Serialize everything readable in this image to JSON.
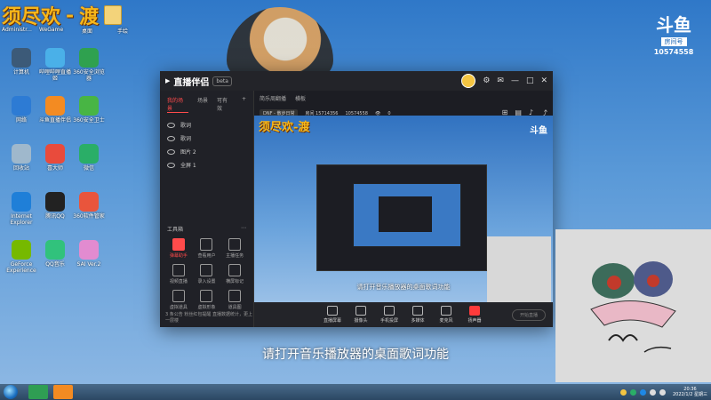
{
  "desktop": {
    "banner": {
      "text1": "须尽欢",
      "dash": "-",
      "text2": "渡"
    },
    "top_labels": [
      "Administr...",
      "WeGame",
      "桌面",
      "手绘"
    ],
    "icons": [
      {
        "label": "计算机",
        "color": "#3c5a78"
      },
      {
        "label": "哔哩哔哩直播姬",
        "color": "#4ab0e8"
      },
      {
        "label": "360安全浏览器",
        "color": "#2fa14f"
      },
      {
        "label": "网络",
        "color": "#2d7bd4"
      },
      {
        "label": "斗鱼直播伴侣",
        "color": "#f38b22"
      },
      {
        "label": "360安全卫士",
        "color": "#48b544"
      },
      {
        "label": "回收站",
        "color": "#9fb8cc"
      },
      {
        "label": "喜大师",
        "color": "#e94b3c"
      },
      {
        "label": "微信",
        "color": "#2aae67"
      },
      {
        "label": "Internet Explorer",
        "color": "#1f7fd8"
      },
      {
        "label": "腾讯QQ",
        "color": "#222222"
      },
      {
        "label": "360软件管家",
        "color": "#e9553c"
      },
      {
        "label": "GeForce Experience",
        "color": "#76b900"
      },
      {
        "label": "QQ音乐",
        "color": "#31c27c"
      },
      {
        "label": "SAI Ver.2",
        "color": "#e28bd0"
      }
    ],
    "brand": {
      "logo": "斗鱼",
      "sub": "房间号",
      "room_id": "10574558"
    }
  },
  "app": {
    "title": "直播伴侣",
    "version": "beta",
    "left_tabs": [
      "我的场景",
      "场景",
      "可有效"
    ],
    "scenes": [
      "歌词",
      "歌词",
      "图片 2",
      "全屏 1"
    ],
    "tools_title": "工具箱",
    "tools": [
      {
        "label": "弹幕助手",
        "red": true
      },
      {
        "label": "查看用户",
        "red": false
      },
      {
        "label": "主播任务",
        "red": false
      },
      {
        "label": "视频直播",
        "red": false
      },
      {
        "label": "录入设置",
        "red": false
      },
      {
        "label": "横屏标记",
        "red": false
      },
      {
        "label": "虚拟道具",
        "red": false
      },
      {
        "label": "虚拟形象",
        "red": false
      },
      {
        "label": "道具图",
        "red": false
      }
    ],
    "left_bottom": "3 条公告  粉丝红包提醒  直播数据统计，更上一层楼",
    "main_tabs": [
      "简乐周翻播",
      "横板"
    ],
    "info": {
      "category": "DNF - 散步日常",
      "room": "房间 15714356",
      "id": "10574558",
      "viewers": "0"
    },
    "preview": {
      "banner": "须尽欢-渡",
      "caption": "请打开音乐播放器的桌面歌词功能",
      "logo": "斗鱼"
    },
    "bottom_buttons": [
      {
        "label": "直播屏幕",
        "red": false
      },
      {
        "label": "摄像头",
        "red": false
      },
      {
        "label": "手机投屏",
        "red": false
      },
      {
        "label": "多媒体",
        "red": false
      },
      {
        "label": "麦克风",
        "red": false
      },
      {
        "label": "扬声器",
        "red": true
      }
    ],
    "start_live": "开始直播"
  },
  "subtitle": "请打开音乐播放器的桌面歌词功能",
  "taskbar": {
    "time": "20:36",
    "date": "2022/1/2 星期三"
  }
}
